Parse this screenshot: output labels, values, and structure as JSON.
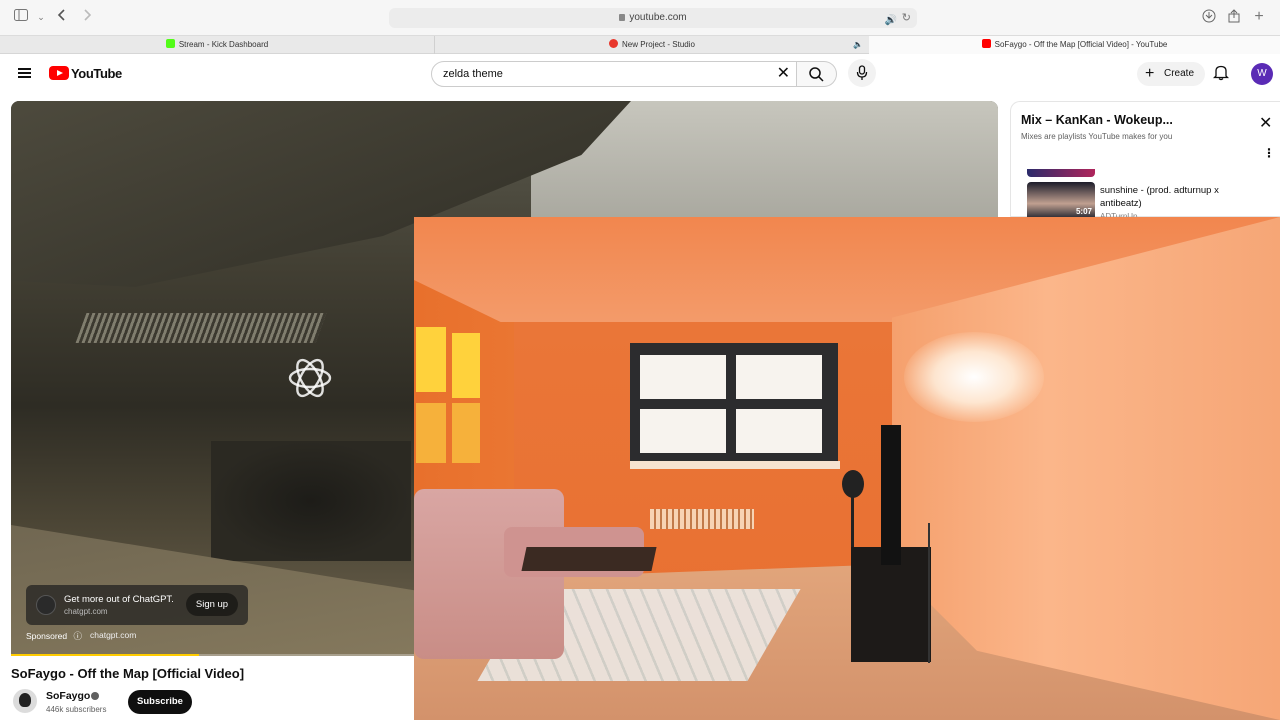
{
  "browser": {
    "url": "youtube.com",
    "tabs": [
      {
        "label": "Stream - Kick Dashboard",
        "favicon_color": "#53fc18"
      },
      {
        "label": "New Project - Studio",
        "favicon_color": "#e8372c"
      },
      {
        "label": "SoFaygo - Off the Map [Official Video] - YouTube",
        "favicon_color": "#ff0000"
      }
    ]
  },
  "youtube": {
    "logo_text": "YouTube",
    "search": {
      "value": "zelda theme",
      "placeholder": "Search"
    },
    "create_label": "Create",
    "avatar_letter": "W",
    "accent": "#ff0000"
  },
  "video": {
    "title": "SoFaygo - Off the Map [Official Video]",
    "channel": "SoFaygo",
    "subscribers": "446k subscribers",
    "subscribe_label": "Subscribe",
    "progress": 0.19,
    "ad": {
      "headline": "Get more out of ChatGPT.",
      "domain": "chatgpt.com",
      "cta": "Sign up",
      "sponsored_label": "Sponsored",
      "sponsored_domain": "chatgpt.com"
    }
  },
  "mix": {
    "title": "Mix – KanKan - Wokeup...",
    "subtitle": "Mixes are playlists YouTube makes for you",
    "item": {
      "title": "sunshine - (prod. adturnup x antibeatz)",
      "channel": "ADTurnUp",
      "duration": "5:07"
    }
  },
  "icons": [
    "sidebar-icon",
    "back-icon",
    "forward-icon",
    "lock-icon",
    "speaker-icon",
    "reload-icon",
    "download-icon",
    "share-icon",
    "new-tab-icon",
    "menu-icon",
    "clear-icon",
    "search-icon",
    "mic-icon",
    "plus-icon",
    "bell-icon",
    "close-icon",
    "more-icon",
    "verified-icon",
    "info-icon"
  ]
}
